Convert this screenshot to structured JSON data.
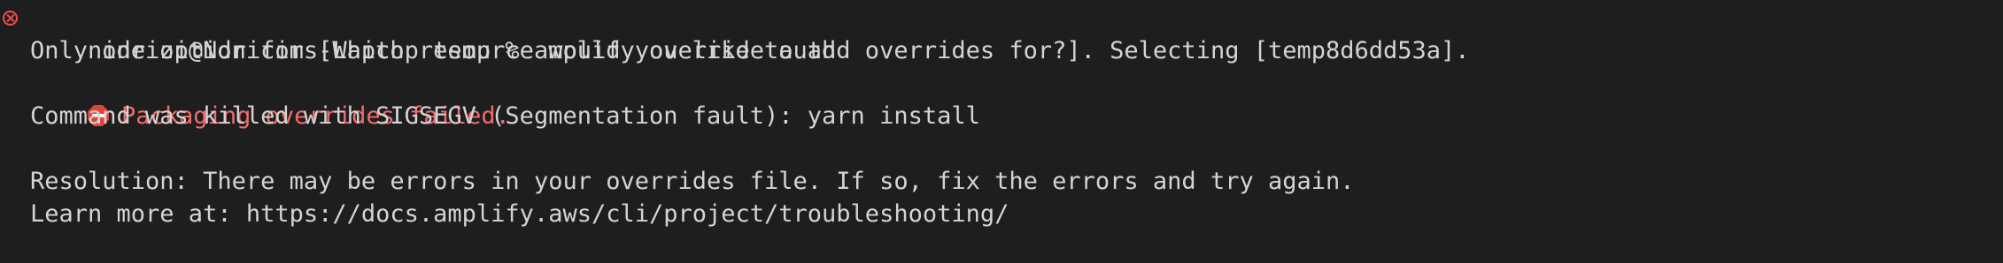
{
  "terminal": {
    "prompt": "nidrizi@Ndricims-Laptop temp % ",
    "command": "amplify override auth",
    "output": {
      "selection_line": "Only one option for [Which resource would you like to add overrides for?]. Selecting [temp8d6dd53a].",
      "error_message": "Packaging overrides failed.",
      "killed_line": "Command was killed with SIGSEGV (Segmentation fault): yarn install",
      "resolution_line": "Resolution: There may be errors in your overrides file. If so, fix the errors and try again.",
      "learn_more_line": "Learn more at: https://docs.amplify.aws/cli/project/troubleshooting/"
    },
    "icons": {
      "gutter": "error-circle-x-icon",
      "error": "stop-sign-icon"
    },
    "colors": {
      "background": "#1e1e1e",
      "text": "#d4d4d4",
      "error": "#f16b6b",
      "gutter_error": "#f14c4c"
    }
  }
}
